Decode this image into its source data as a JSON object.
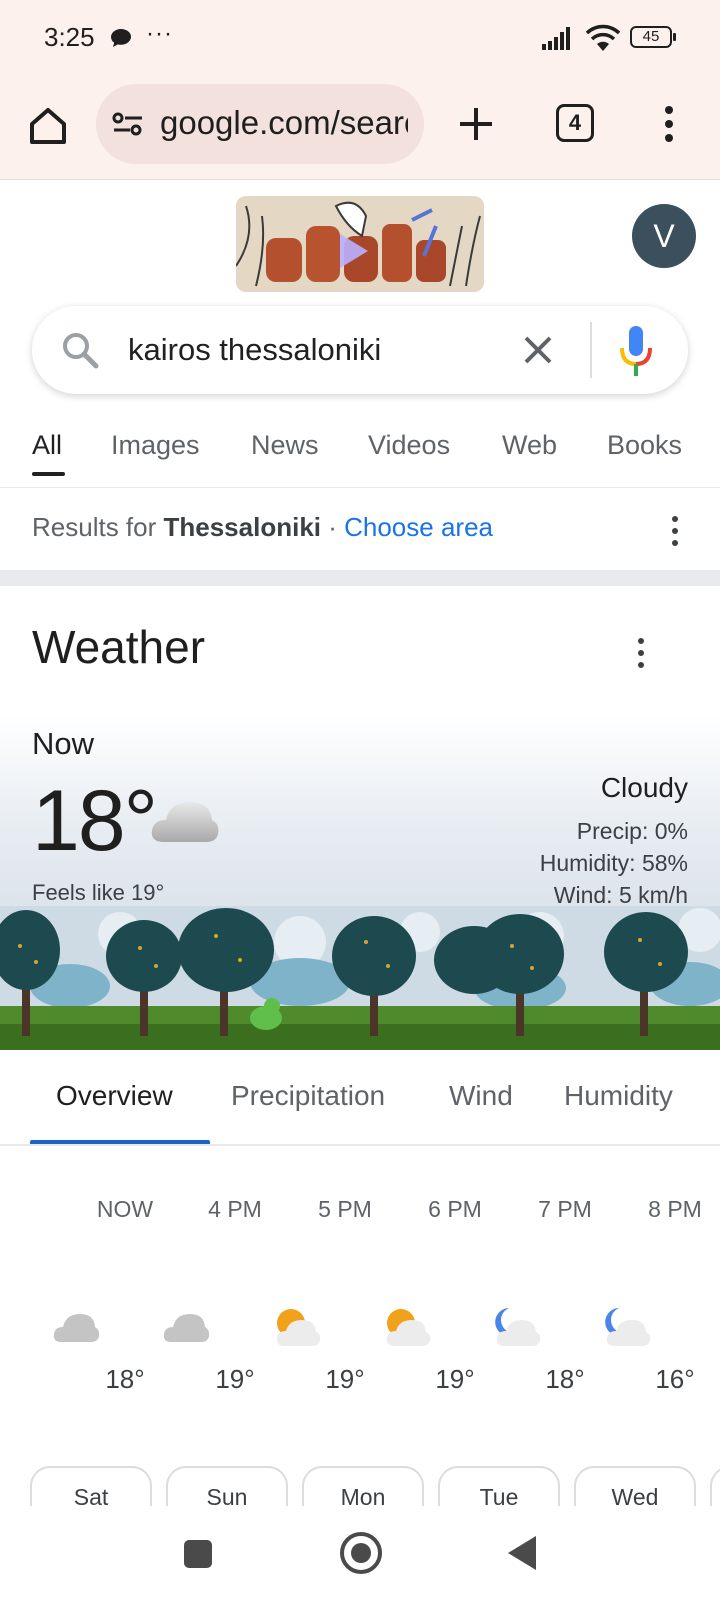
{
  "status_bar": {
    "time": "3:25",
    "more": "···",
    "battery": "45"
  },
  "browser": {
    "url": "google.com/search?q=kairos+thessaloniki",
    "tab_count": "4"
  },
  "google": {
    "avatar_letter": "V",
    "search_query": "kairos thessaloniki",
    "tabs": [
      "All",
      "Images",
      "News",
      "Videos",
      "Web",
      "Books"
    ],
    "results_prefix": "Results for ",
    "results_location": "Thessaloniki",
    "results_sep": " · ",
    "choose_area": "Choose area"
  },
  "weather": {
    "title": "Weather",
    "now_label": "Now",
    "temperature": "18°",
    "feels_like": "Feels like 19°",
    "condition": "Cloudy",
    "precip": "Precip: 0%",
    "humidity": "Humidity: 58%",
    "wind": "Wind: 5 km/h",
    "forecast_tabs": [
      "Overview",
      "Precipitation",
      "Wind",
      "Humidity"
    ],
    "hourly": [
      {
        "time": "NOW",
        "temp": "18°",
        "icon": "cloudy-icon"
      },
      {
        "time": "4 PM",
        "temp": "19°",
        "icon": "cloudy-icon"
      },
      {
        "time": "5 PM",
        "temp": "19°",
        "icon": "partly-sunny-icon"
      },
      {
        "time": "6 PM",
        "temp": "19°",
        "icon": "partly-sunny-icon"
      },
      {
        "time": "7 PM",
        "temp": "18°",
        "icon": "partly-cloudy-night-icon"
      },
      {
        "time": "8 PM",
        "temp": "16°",
        "icon": "partly-cloudy-night-icon"
      }
    ],
    "days": [
      "Sat",
      "Sun",
      "Mon",
      "Tue",
      "Wed"
    ]
  },
  "colors": {
    "accent_blue": "#1a73e8",
    "tab_underline": "#1a63c8",
    "toolbar_bg": "#fdf1ee",
    "avatar_bg": "#3c4f5c"
  }
}
